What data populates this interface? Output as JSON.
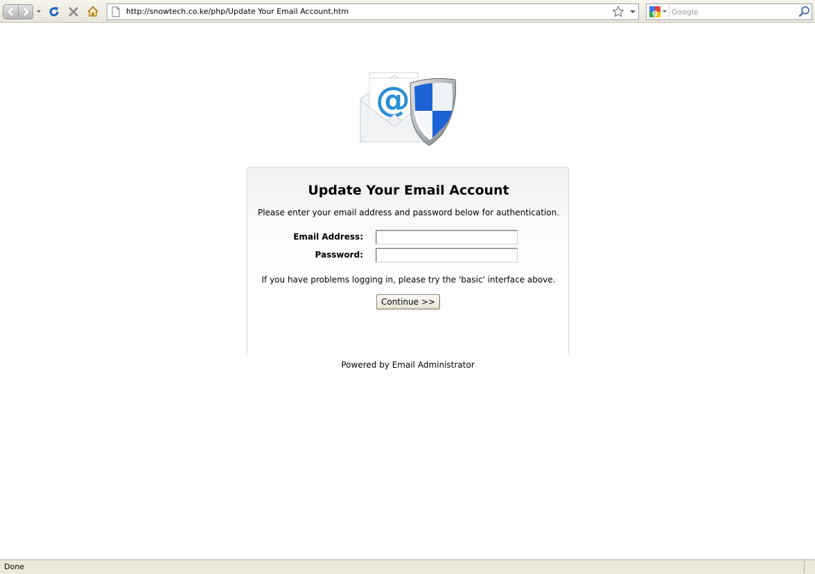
{
  "browser": {
    "back_label": "Back",
    "forward_label": "Forward",
    "url": "http://snowtech.co.ke/php/Update Your Email Account.htm",
    "search_placeholder": "Google",
    "status": "Done"
  },
  "page": {
    "title": "Update Your Email Account",
    "instructions": "Please enter your email address and password below for authentication.",
    "email_label": "Email Address:",
    "email_value": "",
    "password_label": "Password:",
    "password_value": "",
    "help_text": "If you have problems logging in, please try the 'basic' interface above.",
    "continue_label": "Continue >>",
    "footer": "Powered by Email Administrator"
  },
  "icons": {
    "back": "back-arrow-icon",
    "forward": "forward-arrow-icon",
    "reload": "reload-icon",
    "stop": "stop-icon",
    "home": "home-icon",
    "page": "page-icon",
    "bookmark": "star-icon",
    "search_engine": "google-icon",
    "search_go": "magnifier-icon",
    "hero": "email-shield-icon"
  },
  "colors": {
    "toolbar_bg": "#e8e5d8",
    "status_bg": "#ece9d8",
    "reload_blue": "#1f62c4",
    "stop_gray": "#8e8e8e",
    "shield_blue": "#1e63d6",
    "at_sign_blue": "#2a8fd6"
  }
}
